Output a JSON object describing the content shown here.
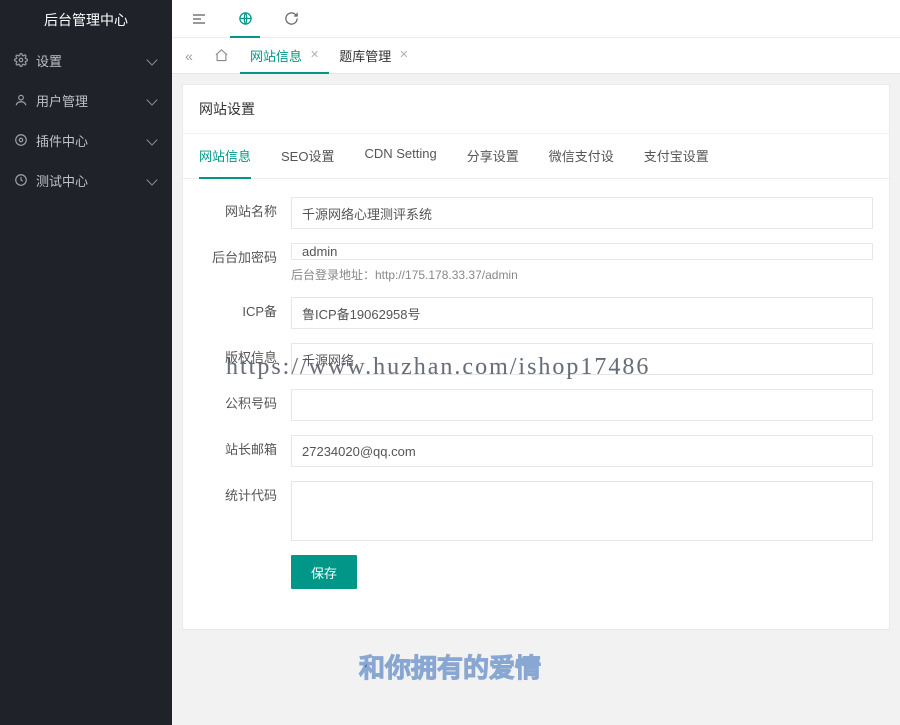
{
  "colors": {
    "accent": "#009688",
    "sidebar_bg": "#20222A"
  },
  "sidebar": {
    "title": "后台管理中心",
    "items": [
      {
        "icon": "gear-icon",
        "label": "设置"
      },
      {
        "icon": "user-icon",
        "label": "用户管理"
      },
      {
        "icon": "plugin-icon",
        "label": "插件中心"
      },
      {
        "icon": "test-icon",
        "label": "测试中心"
      }
    ]
  },
  "topbar": {
    "icons": [
      "menu-icon",
      "globe-icon",
      "refresh-icon"
    ],
    "active_index": 1
  },
  "tabs": {
    "prev_glyph": "«",
    "home_icon": "home-icon",
    "items": [
      {
        "label": "网站信息",
        "active": true
      },
      {
        "label": "题库管理",
        "active": false
      }
    ]
  },
  "card": {
    "title": "网站设置",
    "tabs": [
      {
        "label": "网站信息",
        "active": true
      },
      {
        "label": "SEO设置"
      },
      {
        "label": "CDN Setting"
      },
      {
        "label": "分享设置"
      },
      {
        "label": "微信支付设"
      },
      {
        "label": "支付宝设置"
      }
    ]
  },
  "form": {
    "site_name": {
      "label": "网站名称",
      "value": "千源网络心理测评系统"
    },
    "admin_pass": {
      "label": "后台加密码",
      "value": "admin",
      "help": "后台登录地址：http://175.178.33.37/admin"
    },
    "icp": {
      "label": "ICP备",
      "value": "鲁ICP备19062958号"
    },
    "copyright": {
      "label": "版权信息",
      "value": "千源网络"
    },
    "phone": {
      "label": "公积号码",
      "value": ""
    },
    "email": {
      "label": "站长邮箱",
      "value": "27234020@qq.com"
    },
    "stats": {
      "label": "统计代码",
      "value": ""
    },
    "save_label": "保存"
  },
  "overlay": {
    "watermark": "https://www.huzhan.com/ishop17486",
    "footer": "和你拥有的爱情"
  }
}
